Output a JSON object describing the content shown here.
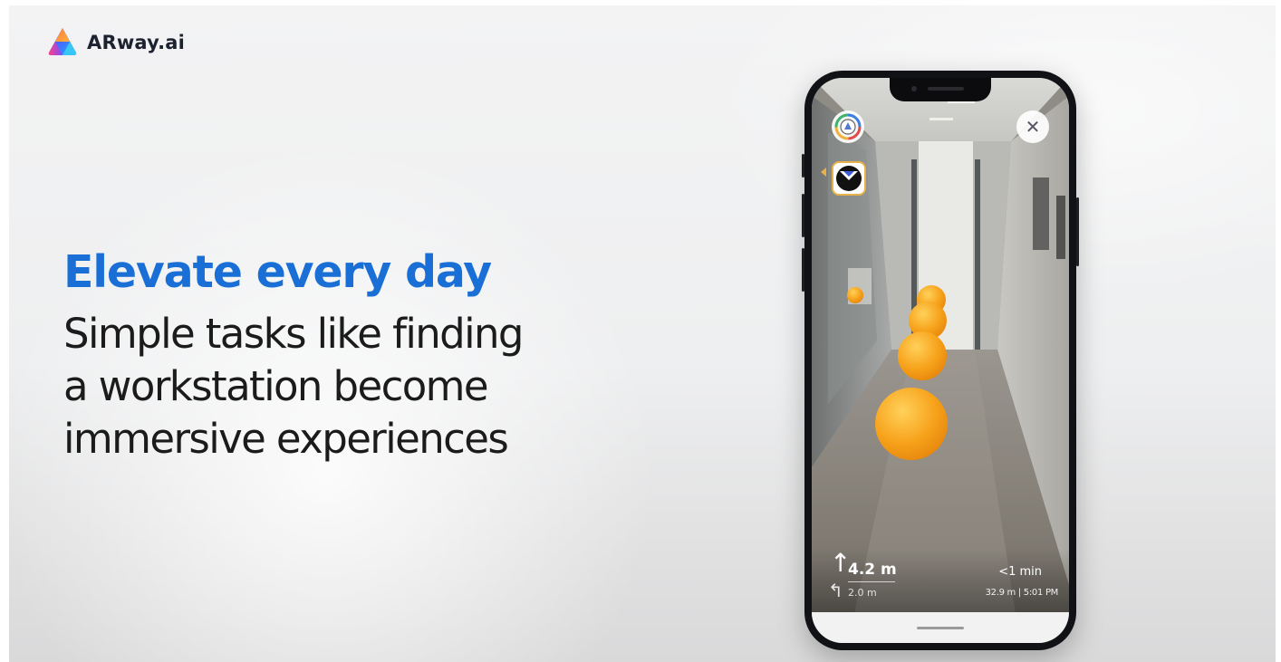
{
  "brand": {
    "name": "ARway.ai",
    "logo_icon": "arway-triangle-logo-icon"
  },
  "hero": {
    "headline": "Elevate every day",
    "body_lines": [
      "Simple tasks like finding",
      "a workstation become",
      "immersive experiences"
    ]
  },
  "phone": {
    "ar_overlay": {
      "top_left_button_icon": "arway-map-icon",
      "compass_button_icon": "compass-icon",
      "close_button_icon": "close-icon"
    },
    "navigation": {
      "current_step_icon": "arrow-up-icon",
      "current_step_distance": "4.2 m",
      "next_step_icon": "turn-left-icon",
      "next_step_distance": "2.0 m",
      "eta": "<1 min",
      "summary": "32.9 m | 5:01 PM"
    }
  },
  "colors": {
    "headline": "#1a6fd6",
    "body_text": "#1b1b1b",
    "ar_waypoint": "#f7a21b",
    "compass_border": "#e8b14a"
  }
}
